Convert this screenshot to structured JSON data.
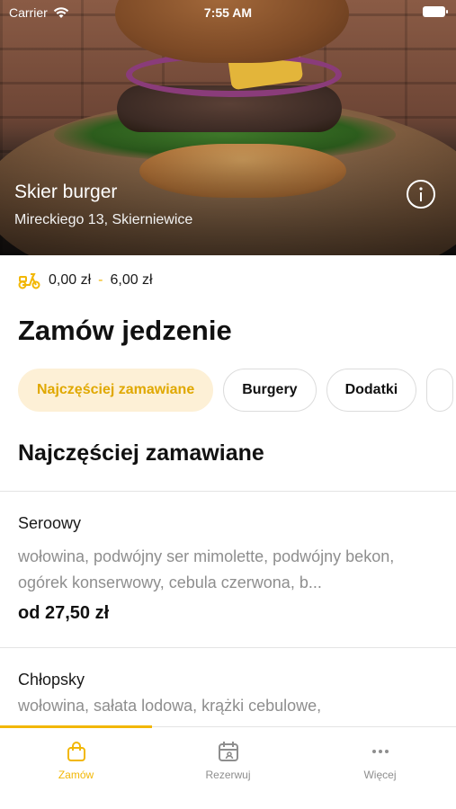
{
  "status_bar": {
    "carrier": "Carrier",
    "time": "7:55 AM"
  },
  "restaurant": {
    "name": "Skier burger",
    "address": "Mireckiego 13, Skierniewice"
  },
  "delivery": {
    "icon": "scooter-icon",
    "min": "0,00 zł",
    "separator": "-",
    "max": "6,00 zł"
  },
  "order_section_title": "Zamów jedzenie",
  "categories": [
    "Najczęściej zamawiane",
    "Burgery",
    "Dodatki"
  ],
  "list_title": "Najczęściej zamawiane",
  "items": [
    {
      "name": "Seroowy",
      "description": "wołowina, podwójny ser mimolette, podwójny bekon, ogórek konserwowy, cebula czerwona, b...",
      "price": "od 27,50 zł"
    },
    {
      "name": "Chłopsky",
      "description": "wołowina, sałata lodowa, krążki cebulowe,"
    }
  ],
  "tabs": [
    {
      "label": "Zamów",
      "icon": "bag-icon"
    },
    {
      "label": "Rezerwuj",
      "icon": "calendar-icon"
    },
    {
      "label": "Więcej",
      "icon": "more-icon"
    }
  ],
  "colors": {
    "accent": "#F2B705",
    "active_chip_bg": "#FDF0D6"
  }
}
